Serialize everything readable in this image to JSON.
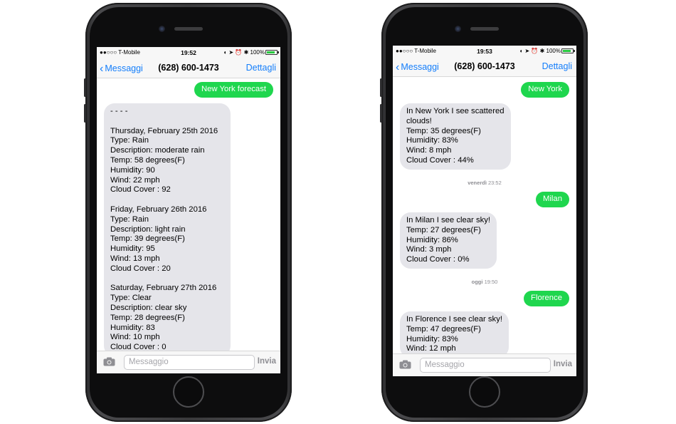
{
  "phones": [
    {
      "status": {
        "carrier": "●●○○○ T-Mobile",
        "time": "19:52",
        "right": "◐ ➤ ⏰ ✱ 100%"
      },
      "nav": {
        "back": "Messaggi",
        "title": "(628) 600-1473",
        "details": "Dettagli"
      },
      "messages": [
        {
          "dir": "out",
          "text": "New York forecast"
        },
        {
          "dir": "in",
          "lines": [
            "- - - -",
            "",
            " Thursday, February 25th 2016",
            "Type: Rain",
            "Description: moderate rain",
            "Temp: 58 degrees(F)",
            "Humidity: 90",
            "Wind: 22 mph",
            "Cloud Cover : 92",
            "",
            " Friday, February 26th 2016",
            "Type: Rain",
            "Description: light rain",
            "Temp: 39 degrees(F)",
            "Humidity: 95",
            "Wind: 13 mph",
            "Cloud Cover : 20",
            "",
            " Saturday, February 27th 2016",
            "Type: Clear",
            "Description: clear sky",
            "Temp: 28 degrees(F)",
            "Humidity: 83",
            "Wind: 10 mph",
            "Cloud Cover : 0"
          ]
        }
      ],
      "composer": {
        "placeholder": "Messaggio",
        "send": "Invia"
      }
    },
    {
      "status": {
        "carrier": "●●○○○ T-Mobile",
        "time": "19:53",
        "right": "◐ ➤ ⏰ ✱ 100%"
      },
      "nav": {
        "back": "Messaggi",
        "title": "(628) 600-1473",
        "details": "Dettagli"
      },
      "messages": [
        {
          "dir": "out",
          "text": "New York"
        },
        {
          "dir": "in",
          "lines": [
            "In New York I see scattered",
            "clouds!",
            "Temp: 35 degrees(F)",
            "Humidity: 83%",
            "Wind: 8 mph",
            "Cloud Cover : 44%"
          ]
        },
        {
          "dir": "ts",
          "day": "venerdì",
          "time": "23:52"
        },
        {
          "dir": "out",
          "text": "Milan"
        },
        {
          "dir": "in",
          "lines": [
            "In Milan I see clear sky!",
            "Temp: 27 degrees(F)",
            "Humidity: 86%",
            "Wind: 3 mph",
            "Cloud Cover : 0%"
          ]
        },
        {
          "dir": "ts",
          "day": "oggi",
          "time": "19:50"
        },
        {
          "dir": "out",
          "text": "Florence"
        },
        {
          "dir": "in",
          "lines": [
            "In Florence I see clear sky!",
            "Temp: 47 degrees(F)",
            "Humidity: 83%",
            "Wind: 12 mph"
          ]
        }
      ],
      "composer": {
        "placeholder": "Messaggio",
        "send": "Invia"
      }
    }
  ]
}
